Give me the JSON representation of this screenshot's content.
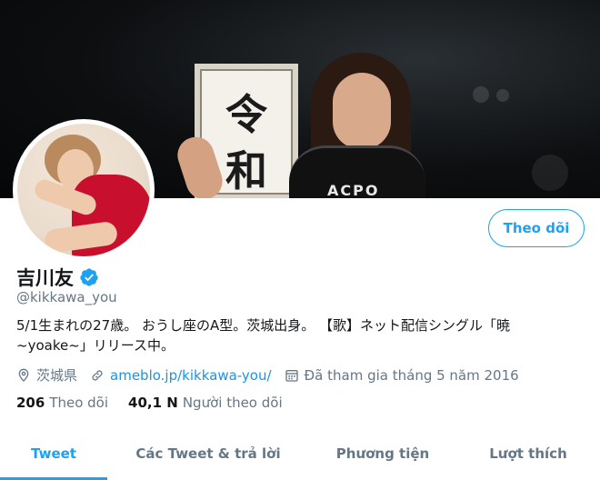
{
  "profile": {
    "display_name": "吉川友",
    "handle": "@kikkawa_you",
    "bio": "5/1生まれの27歳。 おうし座のA型。茨城出身。 【歌】ネット配信シングル「暁 ~yoake~」リリース中。",
    "location": "茨城県",
    "website": "ameblo.jp/kikkawa-you/",
    "joined": "Đã tham gia tháng 5 năm 2016",
    "follow_button": "Theo dõi"
  },
  "stats": {
    "following_count": "206",
    "following_label": "Theo dõi",
    "followers_count": "40,1 N",
    "followers_label": "Người theo dõi"
  },
  "tabs": [
    {
      "label": "Tweet",
      "active": true
    },
    {
      "label": "Các Tweet & trả lời",
      "active": false
    },
    {
      "label": "Phương tiện",
      "active": false
    },
    {
      "label": "Lượt thích",
      "active": false
    }
  ],
  "banner": {
    "board_text_1": "令",
    "board_text_2": "和",
    "shirt_text": "ACPO"
  },
  "colors": {
    "accent": "#1da1f2",
    "link": "#1b95e0",
    "muted": "#657786",
    "text": "#14171a"
  },
  "icons": [
    "verified-badge-icon",
    "location-pin-icon",
    "link-icon",
    "calendar-icon"
  ]
}
